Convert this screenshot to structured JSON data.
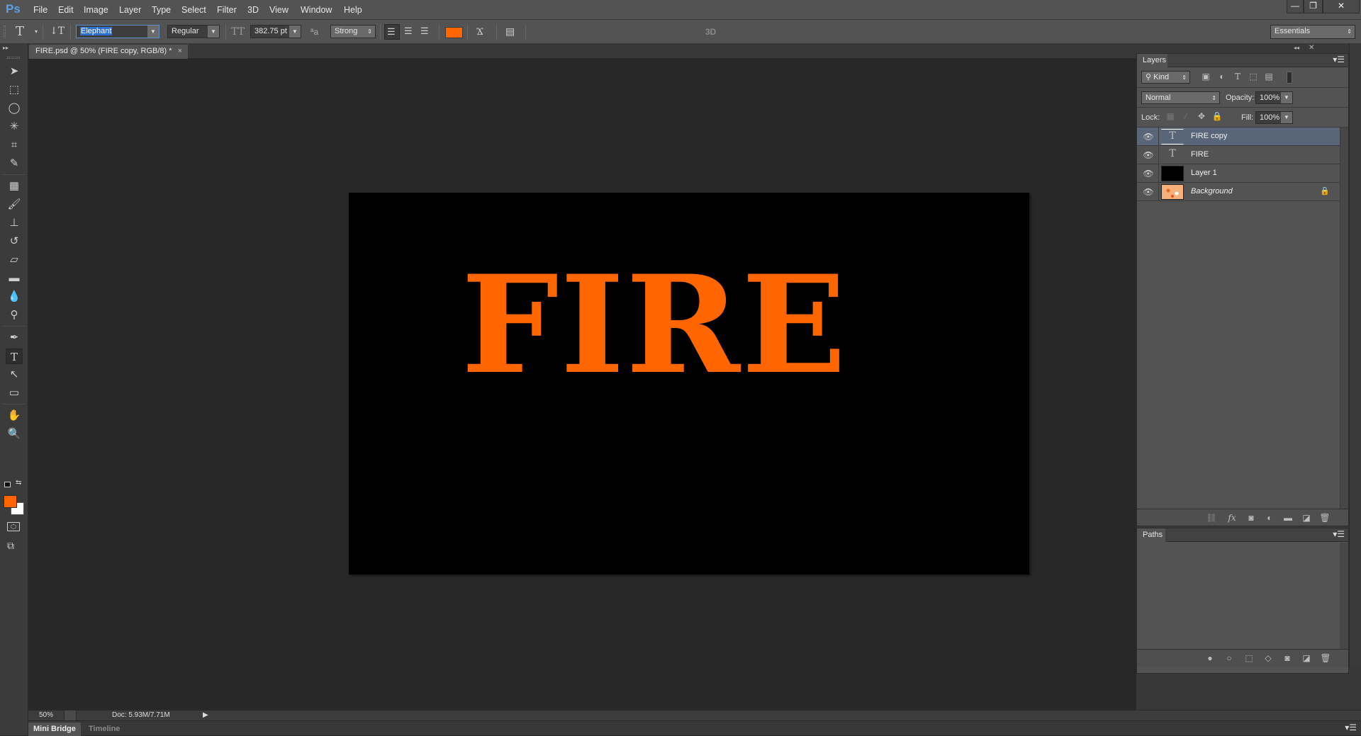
{
  "app": {
    "logo": "Ps",
    "menu": [
      "File",
      "Edit",
      "Image",
      "Layer",
      "Type",
      "Select",
      "Filter",
      "3D",
      "View",
      "Window",
      "Help"
    ],
    "window_controls": {
      "minimize": "—",
      "restore": "❐",
      "close": "✕"
    }
  },
  "options_bar": {
    "tool_icon": "T",
    "orientation_icon": "↓T",
    "font_family": "Elephant",
    "font_style": "Regular",
    "size_icon": "TT",
    "font_size": "382.75 pt",
    "aa_icon": "ªa",
    "anti_alias": "Strong",
    "align": [
      "left",
      "center",
      "right"
    ],
    "text_color": "#ff6600",
    "mode_3d": "3D",
    "workspace": "Essentials"
  },
  "document": {
    "tab_title": "FIRE.psd @ 50% (FIRE copy, RGB/8) *",
    "tab_close": "×",
    "canvas_text": "FIRE",
    "canvas_background": "#000000",
    "text_color": "#ff6600"
  },
  "tools": [
    {
      "name": "move-tool",
      "glyph": "➤"
    },
    {
      "name": "marquee-tool",
      "glyph": "⬚"
    },
    {
      "name": "lasso-tool",
      "glyph": "◯"
    },
    {
      "name": "magic-wand-tool",
      "glyph": "✳"
    },
    {
      "name": "crop-tool",
      "glyph": "⌗"
    },
    {
      "name": "eyedropper-tool",
      "glyph": "✎"
    },
    {
      "name": "healing-brush-tool",
      "glyph": "▦"
    },
    {
      "name": "brush-tool",
      "glyph": "🖌"
    },
    {
      "name": "clone-stamp-tool",
      "glyph": "⊥"
    },
    {
      "name": "history-brush-tool",
      "glyph": "↺"
    },
    {
      "name": "eraser-tool",
      "glyph": "▱"
    },
    {
      "name": "gradient-tool",
      "glyph": "▬"
    },
    {
      "name": "blur-tool",
      "glyph": "💧"
    },
    {
      "name": "dodge-tool",
      "glyph": "⚲"
    },
    {
      "name": "pen-tool",
      "glyph": "✒"
    },
    {
      "name": "type-tool",
      "glyph": "T"
    },
    {
      "name": "path-selection-tool",
      "glyph": "↖"
    },
    {
      "name": "rectangle-tool",
      "glyph": "▭"
    },
    {
      "name": "hand-tool",
      "glyph": "✋"
    },
    {
      "name": "zoom-tool",
      "glyph": "🔍"
    }
  ],
  "colors": {
    "foreground": "#ff6600",
    "background": "#ffffff"
  },
  "layers_panel": {
    "tab": "Layers",
    "filter_kind": "Kind",
    "blend_mode": "Normal",
    "opacity_label": "Opacity:",
    "opacity": "100%",
    "lock_label": "Lock:",
    "fill_label": "Fill:",
    "fill": "100%",
    "layers": [
      {
        "name": "FIRE copy",
        "type": "text",
        "selected": true,
        "visible": true
      },
      {
        "name": "FIRE",
        "type": "text",
        "selected": false,
        "visible": true
      },
      {
        "name": "Layer 1",
        "type": "pixel-black",
        "selected": false,
        "visible": true
      },
      {
        "name": "Background",
        "type": "pixel-texture",
        "selected": false,
        "visible": true,
        "locked": true
      }
    ],
    "footer_icons": [
      "link-icon",
      "fx-icon",
      "mask-icon",
      "adjustment-icon",
      "folder-icon",
      "new-layer-icon",
      "trash-icon"
    ]
  },
  "paths_panel": {
    "tab": "Paths",
    "footer_icons": [
      "fill-path-icon",
      "stroke-path-icon",
      "selection-path-icon",
      "work-path-icon",
      "mask-icon",
      "new-path-icon",
      "trash-icon"
    ]
  },
  "status": {
    "zoom": "50%",
    "doc_size": "Doc: 5.93M/7.71M"
  },
  "bottom_tabs": [
    "Mini Bridge",
    "Timeline"
  ]
}
